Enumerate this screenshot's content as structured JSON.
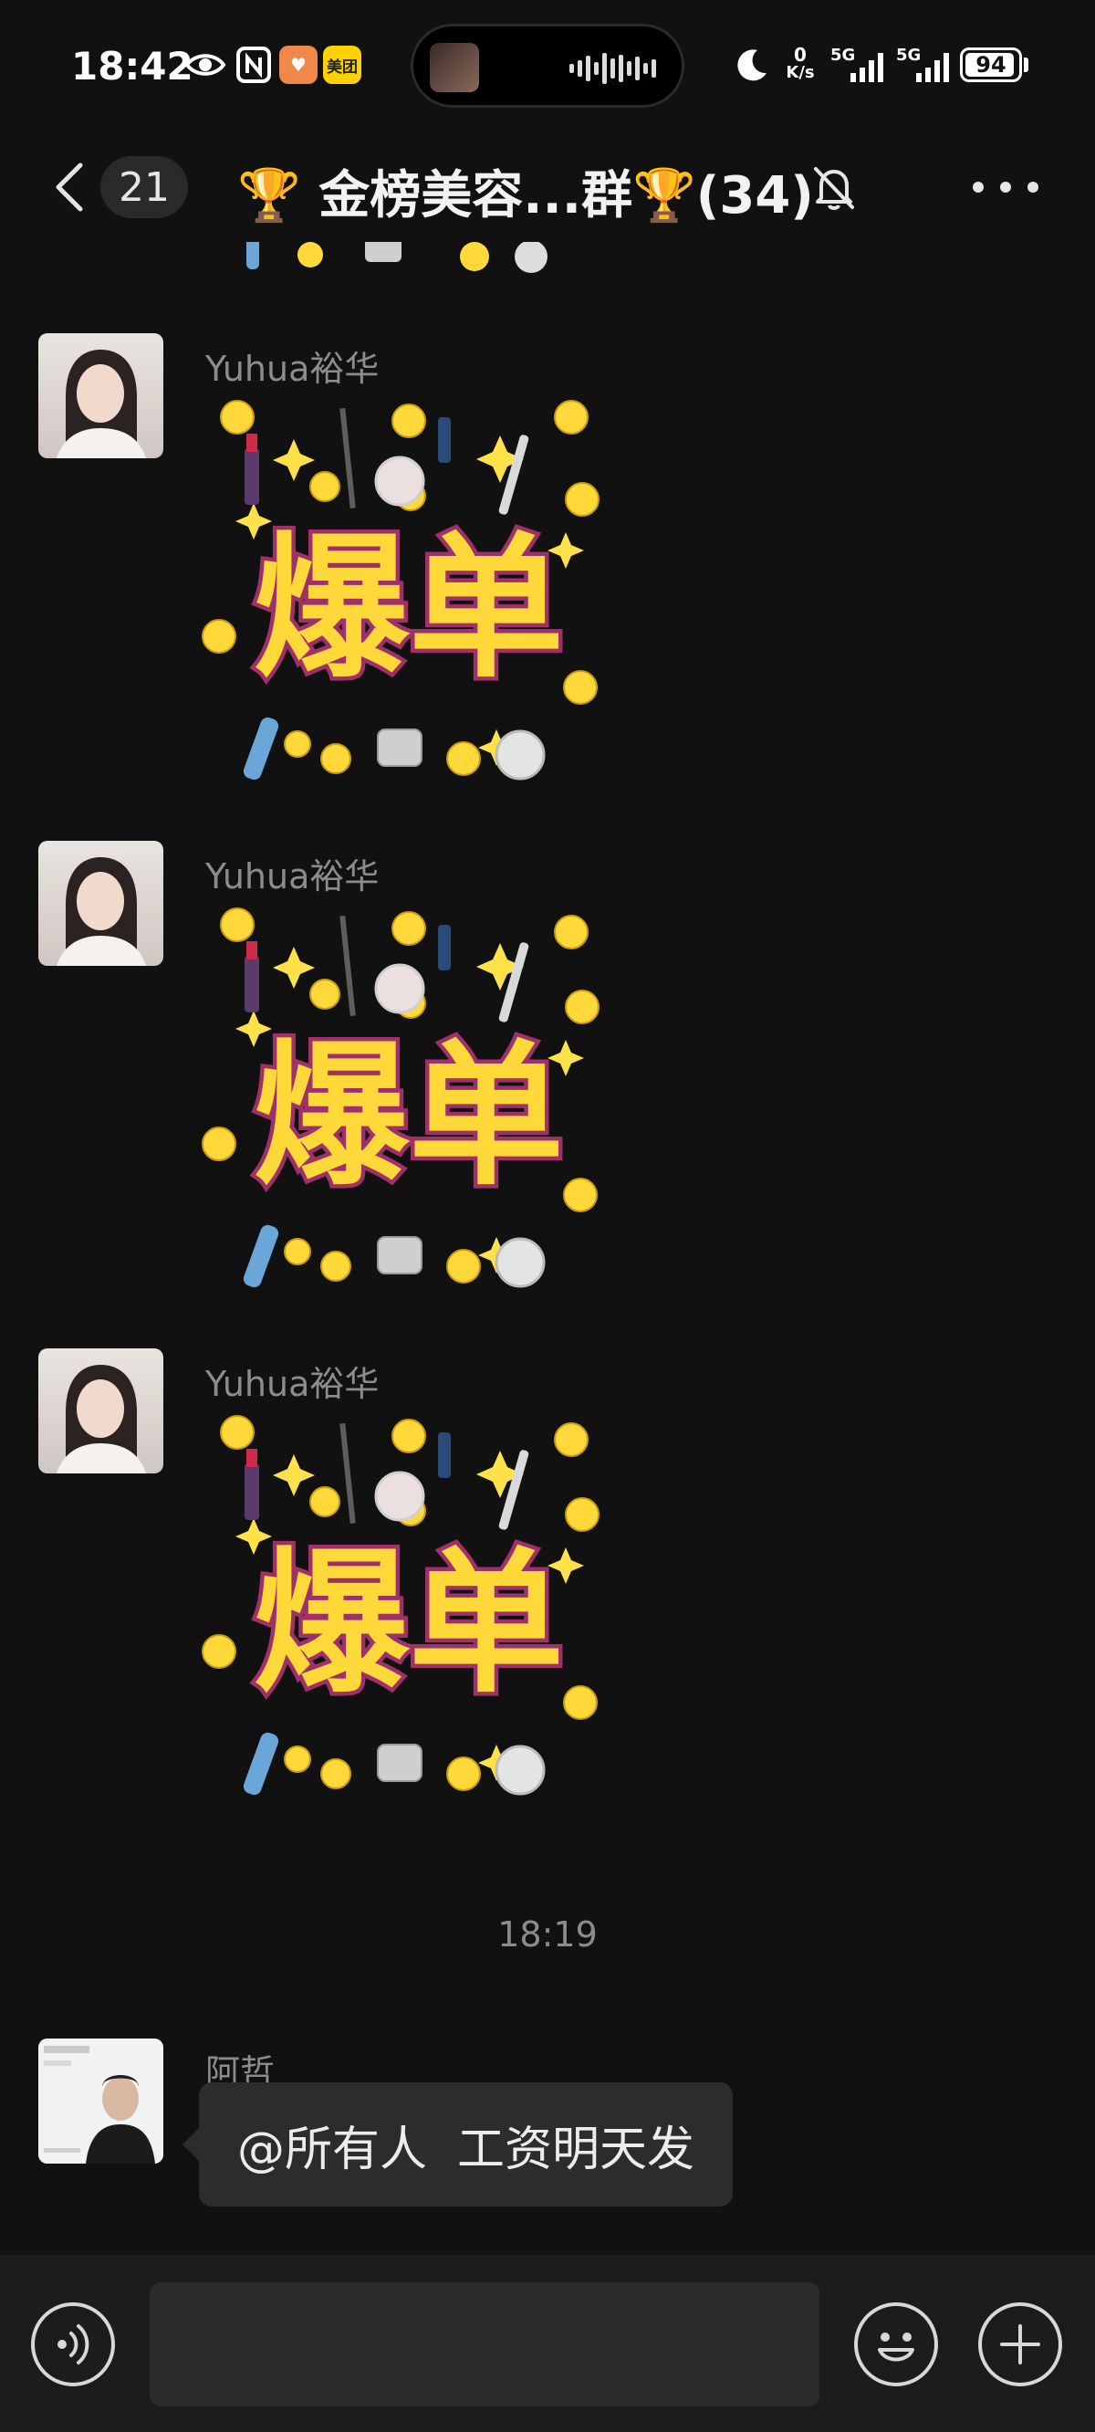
{
  "status_bar": {
    "time": "18:42",
    "app_badge": "美团",
    "net_speed_value": "0",
    "net_speed_unit": "K/s",
    "signal_1": "5G",
    "signal_2": "5G",
    "battery": "94"
  },
  "header": {
    "unread_count": "21",
    "title": "🏆 金榜美容...群🏆(34)"
  },
  "messages": [
    {
      "type": "sticker",
      "sender": "Yuhua裕华",
      "sticker_text": "爆单"
    },
    {
      "type": "sticker",
      "sender": "Yuhua裕华",
      "sticker_text": "爆单"
    },
    {
      "type": "sticker",
      "sender": "Yuhua裕华",
      "sticker_text": "爆单"
    },
    {
      "type": "time",
      "text": "18:19"
    },
    {
      "type": "text",
      "sender": "阿哲",
      "text": "@所有人  工资明天发"
    }
  ],
  "colors": {
    "background": "#111111",
    "bubble": "#2c2c2c",
    "sender_name": "#8c8c8c",
    "sticker_yellow": "#ffd83a",
    "sticker_outline": "#a0306a"
  }
}
